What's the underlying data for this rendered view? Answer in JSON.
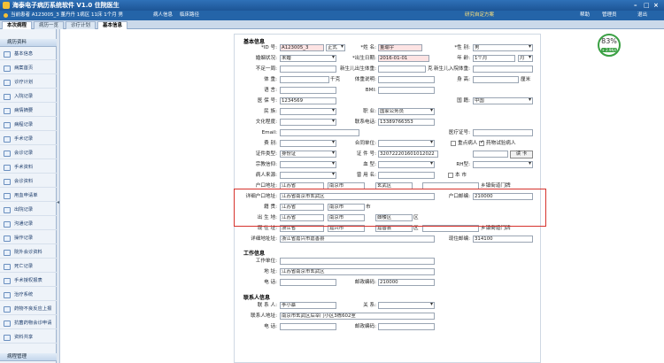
{
  "app": {
    "title": "海泰电子病历系统软件 V1.0 住院医生"
  },
  "top": {
    "patient_info": "当前患者 A123005_3 董丹丹 1病区 11床 1个月 男",
    "btn1": "病人信息",
    "btn2": "临床路径",
    "notice": "研究自定方案",
    "right1": "帮助",
    "right2": "管理员",
    "right3": "退出"
  },
  "tabs": [
    "本次病程",
    "病历一览",
    "诊疗计划",
    "基本信息"
  ],
  "sidebar": {
    "header": "病历资料",
    "items": [
      "基本信息",
      "病案首页",
      "诊疗计划",
      "入院记录",
      "病情摘要",
      "病程记录",
      "手术记录",
      "会诊记录",
      "手术资料",
      "会诊资料",
      "用血申请单",
      "出院记录",
      "沟通记录",
      "操作记录",
      "院外会诊资料",
      "死亡记录",
      "手术授权报表",
      "治疗系统",
      "药物不良反应上报",
      "抗菌药物会诊申请",
      "资料共享"
    ],
    "footer": "病程管理"
  },
  "badge": {
    "value": "83%",
    "sub": "+ 2.9K/s"
  },
  "form": {
    "sec_basic": "基本信息",
    "id_label": "*ID 号:",
    "id_value": "A123005_3",
    "id_type": "正式",
    "name_label": "*姓 名:",
    "name_value": "董瑜宇",
    "sex_label": "*性 别:",
    "sex_value": "男",
    "marital_label": "婚姻状况:",
    "marital_value": "未婚",
    "birth_label": "*出生日期:",
    "birth_value": "2016-01-01",
    "age_label": "年 龄:",
    "age_value": "1个月",
    "age_unit": "月",
    "noweek_label": "不足一周:",
    "newborn_w_label": "新生儿出生体重:",
    "newborn_w_unit": "克",
    "newborn_in_label": "新生儿入院体重:",
    "newborn_in_unit": "克",
    "weight_label": "体 重:",
    "weight_unit": "千克",
    "weight_note_label": "体重说明:",
    "height_label": "身 高:",
    "height_unit": "厘米",
    "lang_label": "语 言:",
    "bmi_label": "BMI:",
    "insurance_label": "医 保 号:",
    "insurance_value": "1234569",
    "country_label": "国 籍:",
    "country_value": "中国",
    "nation_label": "民 族:",
    "job_label": "职 业:",
    "job_value": "国家公务员",
    "edu_label": "文化程度:",
    "phone_label": "联系电话:",
    "phone_value": "13389766353",
    "email_label": "Email:",
    "medcard_label": "医疗证号:",
    "fee_label": "费 别:",
    "contract_label": "合同单位:",
    "vip_label": "重点病人",
    "drug_label": "药物试验病人",
    "idtype_label": "证件类型:",
    "idtype_value": "身份证",
    "idno_label": "证 件 号:",
    "idno_value": "320722201601012022",
    "readcard": "读 卡",
    "religion_label": "宗教信仰:",
    "blood_label": "血 型:",
    "rh_label": "RH型:",
    "source_label": "病人来源:",
    "alias_label": "曾 用 名:",
    "local_label": "本 市",
    "hukou_label": "户口地址:",
    "hukou_p": "江苏省",
    "hukou_c": "南京市",
    "hukou_d": "玄武区",
    "hukou_suffix": "乡镇街道门牌",
    "hukou_detail_label": "详细户口地址:",
    "hukou_detail": "江苏省南京市玄武区",
    "hukou_zip_label": "户口邮编:",
    "hukou_zip": "210000",
    "origin_label": "籍 贯:",
    "origin_p": "江苏省",
    "origin_c": "南京市",
    "origin_suffix": "市",
    "birthplace_label": "出 生 地:",
    "bp_p": "江苏省",
    "bp_c": "南京市",
    "bp_d": "鼓楼区",
    "bp_suffix": "区",
    "current_label": "现 住 址:",
    "cur_p": "浙江省",
    "cur_c": "嘉兴市",
    "cur_d": "嘉善县",
    "cur_suffix": "区",
    "cur_suffix2": "乡镇街道门牌",
    "cur_detail_label": "详细地址址:",
    "cur_detail": "浙江省嘉兴市嘉善县",
    "cur_zip_label": "现住邮编:",
    "cur_zip": "314100",
    "sec_work": "工作信息",
    "workunit_label": "工作单位:",
    "workaddr_label": "地 址:",
    "workaddr": "江苏省南京市玄武区",
    "workphone_label": "电 话:",
    "workzip_label": "邮政编码:",
    "workzip": "210000",
    "sec_contact": "联系人信息",
    "contact_label": "联 系 人:",
    "contact": "李小慕",
    "relation_label": "关 系:",
    "contact_addr_label": "联系人地址:",
    "contact_addr": "南京市玄武区后宰门小区3栋602室",
    "contact_phone_label": "电 话:",
    "contact_zip_label": "邮政编码:"
  }
}
